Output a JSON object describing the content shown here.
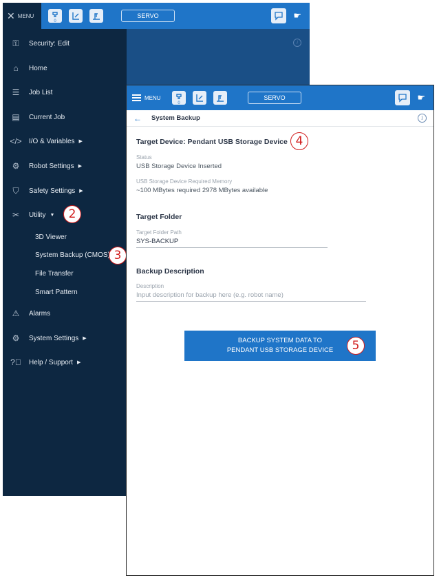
{
  "header": {
    "menu_label": "MENU",
    "servo_label": "SERVO",
    "job_count": "0"
  },
  "menu": {
    "items": [
      {
        "label": "Security: Edit",
        "icon": "key-icon"
      },
      {
        "label": "Home",
        "icon": "home-icon"
      },
      {
        "label": "Job List",
        "icon": "list-icon"
      },
      {
        "label": "Current Job",
        "icon": "document-icon"
      },
      {
        "label": "I/O & Variables",
        "icon": "code-icon"
      },
      {
        "label": "Robot Settings",
        "icon": "robot-icon"
      },
      {
        "label": "Safety Settings",
        "icon": "shield-icon"
      },
      {
        "label": "Utility",
        "icon": "tools-icon"
      }
    ],
    "utility_subitems": [
      "3D Viewer",
      "System Backup (CMOS)",
      "File Transfer",
      "Smart Pattern"
    ],
    "lower_items": [
      {
        "label": "Alarms",
        "icon": "warning-icon"
      },
      {
        "label": "System Settings",
        "icon": "gear-icon"
      },
      {
        "label": "Help / Support",
        "icon": "help-icon"
      }
    ]
  },
  "markers": [
    "2",
    "3",
    "4",
    "5"
  ],
  "backup": {
    "page_title": "System Backup",
    "target_device_title": "Target Device: Pendant USB Storage Device",
    "status_label": "Status",
    "status_value": "USB Storage Device Inserted",
    "memory_label": "USB Storage Device Required Memory",
    "memory_value": "~100 MBytes required  2978 MBytes available",
    "target_folder_title": "Target Folder",
    "folder_path_label": "Target Folder Path",
    "folder_path_value": "SYS-BACKUP",
    "description_title": "Backup Description",
    "description_label": "Description",
    "description_placeholder": "Input description for backup here (e.g. robot name)",
    "button_line1": "BACKUP SYSTEM DATA TO",
    "button_line2": "PENDANT USB STORAGE DEVICE"
  },
  "colors": {
    "topbar": "#1f75c8",
    "menu_bg": "#0d2741",
    "accent": "#1f75c8",
    "marker": "#d11b1b"
  }
}
